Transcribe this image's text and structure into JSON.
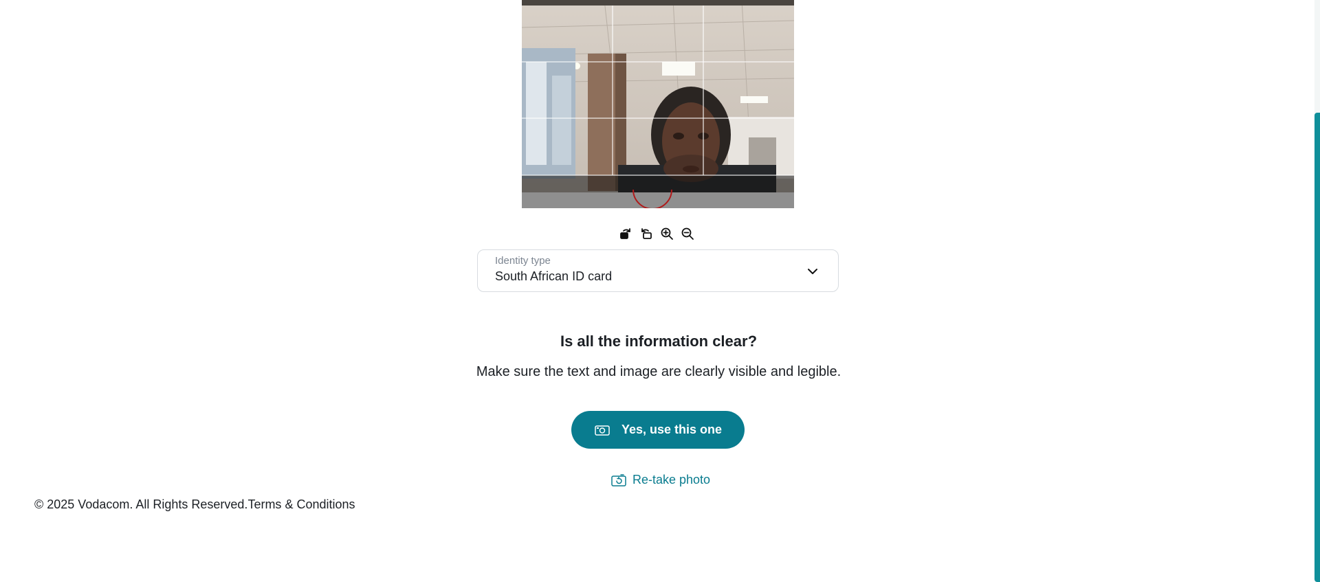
{
  "image_tools": [
    {
      "name": "rotate-right-icon"
    },
    {
      "name": "rotate-left-icon"
    },
    {
      "name": "zoom-in-icon"
    },
    {
      "name": "zoom-out-icon"
    }
  ],
  "identity_select": {
    "label": "Identity type",
    "value": "South African ID card"
  },
  "confirm": {
    "question": "Is all the information clear?",
    "hint": "Make sure the text and image are clearly visible and legible."
  },
  "actions": {
    "primary_label": "Yes, use this one",
    "retake_label": "Re-take photo"
  },
  "footer": {
    "copyright": "© 2025 Vodacom. All Rights Reserved.",
    "terms": "Terms & Conditions"
  },
  "colors": {
    "accent": "#097c8f",
    "scrollbar": "#0f8f9a"
  }
}
